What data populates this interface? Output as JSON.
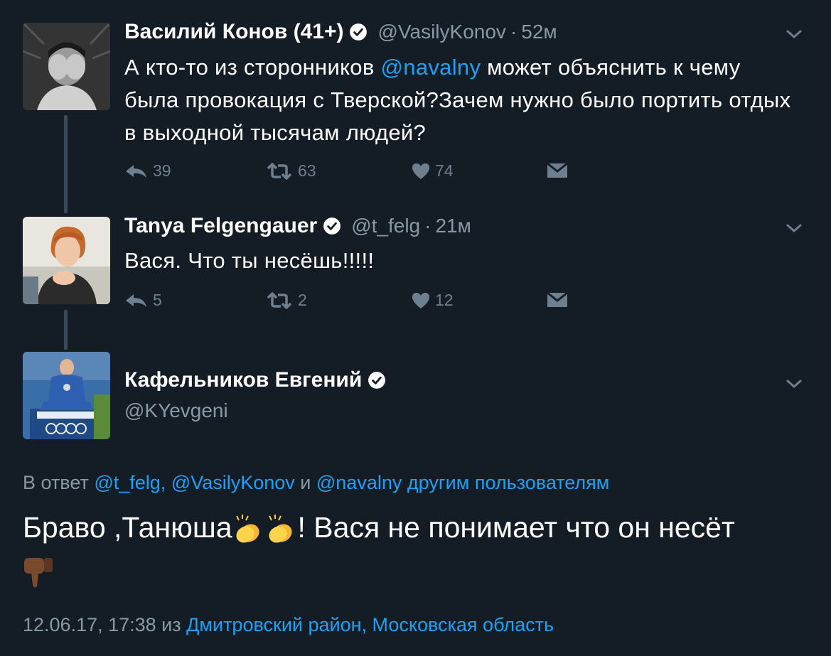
{
  "tweets": [
    {
      "name": "Василий Конов (41+)",
      "handle": "@VasilyKonov",
      "time": "52м",
      "text_parts": [
        "А кто-то из сторонников ",
        "@navalny",
        "  может объяснить к чему была провокация с Тверской?Зачем нужно было портить отдых в выходной тысячам людей?"
      ],
      "replies": "39",
      "retweets": "63",
      "likes": "74"
    },
    {
      "name": "Tanya Felgengauer",
      "handle": "@t_felg",
      "time": "21м",
      "text": "Вася. Что ты несёшь!!!!!",
      "replies": "5",
      "retweets": "2",
      "likes": "12"
    }
  ],
  "main_tweet": {
    "name": "Кафельников Евгений",
    "handle": "@KYevgeni",
    "reply_prefix": "В ответ ",
    "reply_mentions": "@t_felg, @VasilyKonov",
    "reply_and": " и ",
    "reply_mention_last": "@navalny",
    "reply_others": " другим пользователям",
    "text_before": "Браво ,Танюша",
    "text_after": "! Вася не понимает что он несёт",
    "timestamp": "12.06.17, 17:38",
    "from_word": " из ",
    "location": "Дмитровский район, Московская область"
  },
  "icons": [
    "verified-badge-icon",
    "chevron-down-icon",
    "reply-icon",
    "retweet-icon",
    "heart-icon",
    "direct-message-icon",
    "clapping-hands-emoji",
    "thumbs-down-emoji"
  ],
  "colors": {
    "background": "#141d26",
    "link": "#1da1f2",
    "muted": "#8899a6",
    "action": "#6e7f8f",
    "thread_line": "#3b4a5a"
  }
}
